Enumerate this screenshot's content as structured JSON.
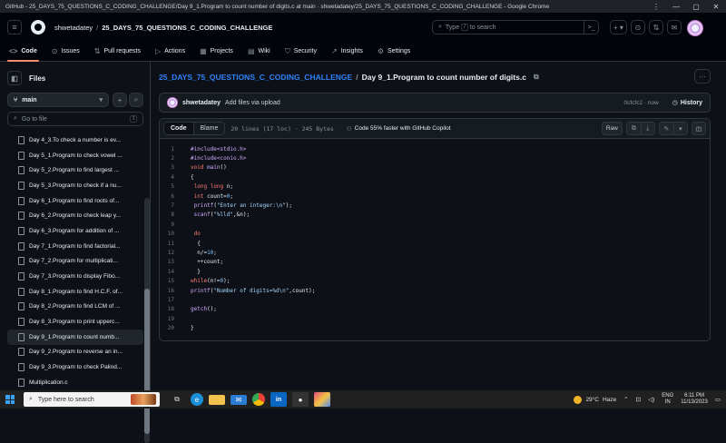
{
  "window": {
    "title": "GitHub - 25_DAYS_75_QUESTIONS_C_CODING_CHALLENGE/Day 9_1.Program to count number of digits.c at main · shwetadatey/25_DAYS_75_QUESTIONS_C_CODING_CHALLENGE - Google Chrome",
    "min": "—",
    "max": "▢",
    "close": "✕",
    "dots": "⋮"
  },
  "header": {
    "owner": "shwetadatey",
    "sep": "/",
    "repo": "25_DAYS_75_QUESTIONS_C_CODING_CHALLENGE",
    "search_pre": "Type",
    "search_kbd": "/",
    "search_post": "to search",
    "plus": "+ ▾"
  },
  "nav": {
    "items": [
      {
        "icon": "<>",
        "label": "Code"
      },
      {
        "icon": "⊙",
        "label": "Issues"
      },
      {
        "icon": "⇅",
        "label": "Pull requests"
      },
      {
        "icon": "▷",
        "label": "Actions"
      },
      {
        "icon": "▦",
        "label": "Projects"
      },
      {
        "icon": "▤",
        "label": "Wiki"
      },
      {
        "icon": "⛉",
        "label": "Security"
      },
      {
        "icon": "↗",
        "label": "Insights"
      },
      {
        "icon": "⚙",
        "label": "Settings"
      }
    ]
  },
  "sidebar": {
    "title": "Files",
    "branch": "main",
    "goto_placeholder": "Go to file",
    "goto_kbd": "t",
    "files": [
      "Day 4_3.To check a number is ev...",
      "Day 5_1.Program to check vowel ...",
      "Day 5_2.Program to find largest ...",
      "Day 5_3.Program to check if a nu...",
      "Day 6_1.Program to find roots of...",
      "Day 6_2.Program to check leap y...",
      "Day 6_3.Program for addition of ...",
      "Day 7_1.Program to find factorial...",
      "Day 7_2.Program for multiplicati...",
      "Day 7_3.Program to display Fibo...",
      "Day 8_1.Program to find H.C.F. of...",
      "Day 8_2.Program to find LCM of ...",
      "Day 8_3.Program to print upperc...",
      "Day 9_1.Program to count numb...",
      "Day 9_2.Program to reverse an in...",
      "Day 9_3.Program to check Palind...",
      "Multiplication.c"
    ],
    "active_index": 13
  },
  "file": {
    "repo_link": "25_DAYS_75_QUESTIONS_C_CODING_CHALLENGE",
    "sep": "/",
    "name": "Day 9_1.Program to count number of digits.c"
  },
  "commit": {
    "author": "shwetadatey",
    "message": "Add files via upload",
    "sha_time": "0cfcfc2 · now",
    "history": "History"
  },
  "codebar": {
    "tab_code": "Code",
    "tab_blame": "Blame",
    "meta": "20 lines (17 loc) · 245 Bytes",
    "copilot": "Code 55% faster with GitHub Copilot",
    "raw": "Raw"
  },
  "code_lines": [
    "#include<stdio.h>",
    "#include<conio.h>",
    "void main()",
    "{",
    " long long n;",
    " int count=0;",
    " printf(\"Enter an integer:\\n\");",
    " scanf(\"%lld\",&n);",
    "",
    " do",
    "  {",
    "  n/=10;",
    "  ++count;",
    "  }",
    "while(n!=0);",
    "printf(\"Number of digits=%d\\n\",count);",
    "",
    "getch();",
    "",
    "}"
  ],
  "taskbar": {
    "search_placeholder": "Type here to search",
    "temp": "29°C",
    "weather": "Haze",
    "lang1": "ENG",
    "lang2": "IN",
    "time": "6:11 PM",
    "date": "11/13/2023"
  }
}
